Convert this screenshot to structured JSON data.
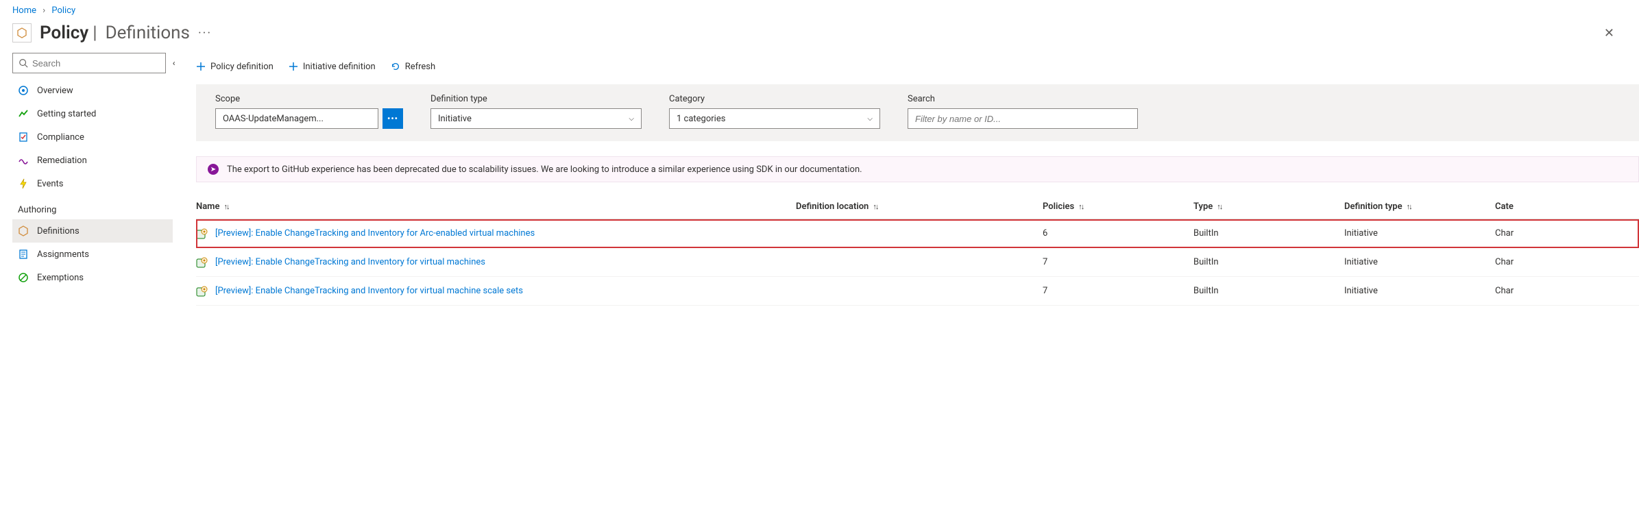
{
  "breadcrumb": {
    "home": "Home",
    "policy": "Policy"
  },
  "header": {
    "title_strong": "Policy",
    "title_light": "Definitions"
  },
  "sidebar": {
    "search_placeholder": "Search",
    "items": [
      {
        "label": "Overview"
      },
      {
        "label": "Getting started"
      },
      {
        "label": "Compliance"
      },
      {
        "label": "Remediation"
      },
      {
        "label": "Events"
      }
    ],
    "authoring_header": "Authoring",
    "authoring_items": [
      {
        "label": "Definitions"
      },
      {
        "label": "Assignments"
      },
      {
        "label": "Exemptions"
      }
    ]
  },
  "toolbar": {
    "policy_def": "Policy definition",
    "initiative_def": "Initiative definition",
    "refresh": "Refresh"
  },
  "filters": {
    "scope_label": "Scope",
    "scope_value": "OAAS-UpdateManagem...",
    "deftype_label": "Definition type",
    "deftype_value": "Initiative",
    "category_label": "Category",
    "category_value": "1 categories",
    "search_label": "Search",
    "search_placeholder": "Filter by name or ID..."
  },
  "banner": {
    "text": "The export to GitHub experience has been deprecated due to scalability issues. We are looking to introduce a similar experience using SDK in our documentation."
  },
  "table": {
    "columns": {
      "name": "Name",
      "location": "Definition location",
      "policies": "Policies",
      "type": "Type",
      "deftype": "Definition type",
      "category": "Cate"
    },
    "rows": [
      {
        "name": "[Preview]: Enable ChangeTracking and Inventory for Arc-enabled virtual machines",
        "location": "",
        "policies": "6",
        "type": "BuiltIn",
        "deftype": "Initiative",
        "category": "Char",
        "highlighted": true
      },
      {
        "name": "[Preview]: Enable ChangeTracking and Inventory for virtual machines",
        "location": "",
        "policies": "7",
        "type": "BuiltIn",
        "deftype": "Initiative",
        "category": "Char",
        "highlighted": false
      },
      {
        "name": "[Preview]: Enable ChangeTracking and Inventory for virtual machine scale sets",
        "location": "",
        "policies": "7",
        "type": "BuiltIn",
        "deftype": "Initiative",
        "category": "Char",
        "highlighted": false
      }
    ]
  }
}
